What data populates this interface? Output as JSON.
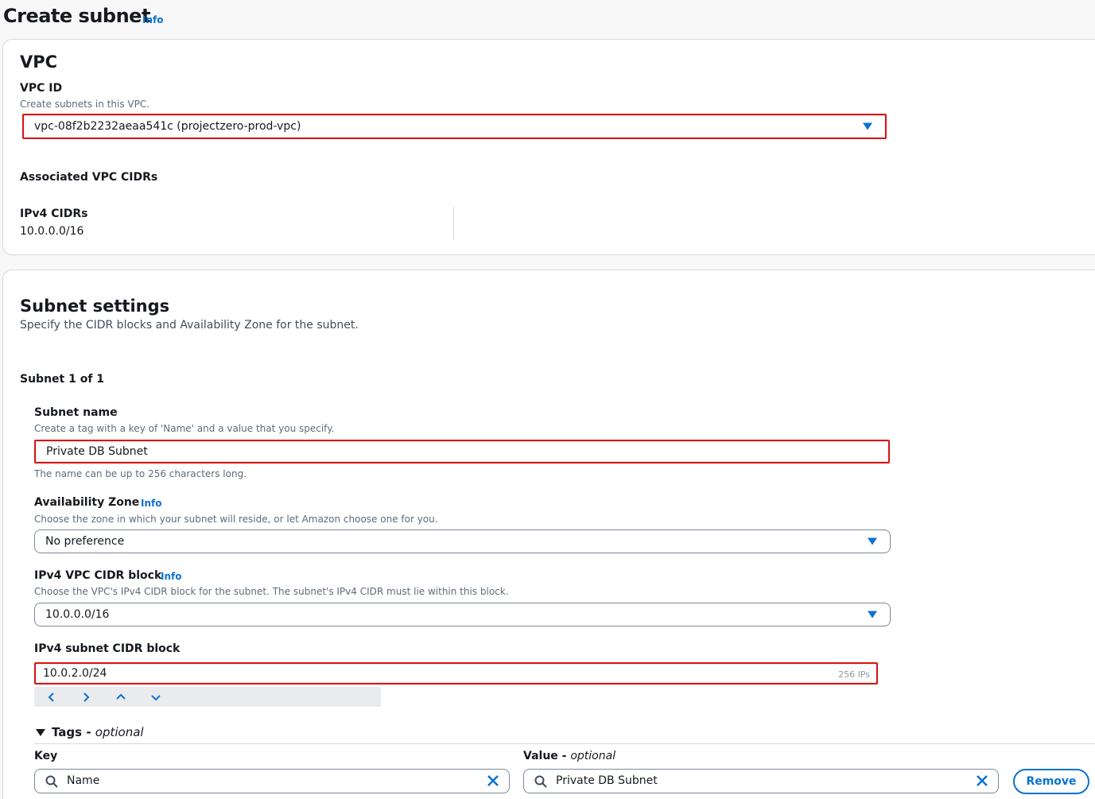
{
  "page": {
    "title": "Create subnet",
    "info": "Info"
  },
  "vpc": {
    "heading": "VPC",
    "vpc_id_label": "VPC ID",
    "vpc_id_desc": "Create subnets in this VPC.",
    "vpc_id_value": "vpc-08f2b2232aeaa541c (projectzero-prod-vpc)",
    "assoc_heading": "Associated VPC CIDRs",
    "ipv4_label": "IPv4 CIDRs",
    "ipv4_value": "10.0.0.0/16"
  },
  "subnet_settings": {
    "heading": "Subnet settings",
    "description": "Specify the CIDR blocks and Availability Zone for the subnet.",
    "counter": "Subnet 1 of 1",
    "name_label": "Subnet name",
    "name_desc": "Create a tag with a key of 'Name' and a value that you specify.",
    "name_value": "Private DB Subnet",
    "name_hint": "The name can be up to 256 characters long.",
    "az_label": "Availability Zone",
    "az_info": "Info",
    "az_desc": "Choose the zone in which your subnet will reside, or let Amazon choose one for you.",
    "az_value": "No preference",
    "vpc_cidr_label": "IPv4 VPC CIDR block",
    "vpc_cidr_info": "Info",
    "vpc_cidr_desc": "Choose the VPC's IPv4 CIDR block for the subnet. The subnet's IPv4 CIDR must lie within this block.",
    "vpc_cidr_value": "10.0.0.0/16",
    "subnet_cidr_label": "IPv4 subnet CIDR block",
    "subnet_cidr_value": "10.0.2.0/24",
    "subnet_cidr_count": "256 IPs"
  },
  "tags": {
    "heading": "Tags",
    "heading_optional": "optional",
    "key_label": "Key",
    "value_label": "Value",
    "value_optional": "optional",
    "key_value": "Name",
    "value_value": "Private DB Subnet",
    "remove_label": "Remove"
  },
  "colors": {
    "link": "#0972d3",
    "highlight": "#d91515"
  }
}
